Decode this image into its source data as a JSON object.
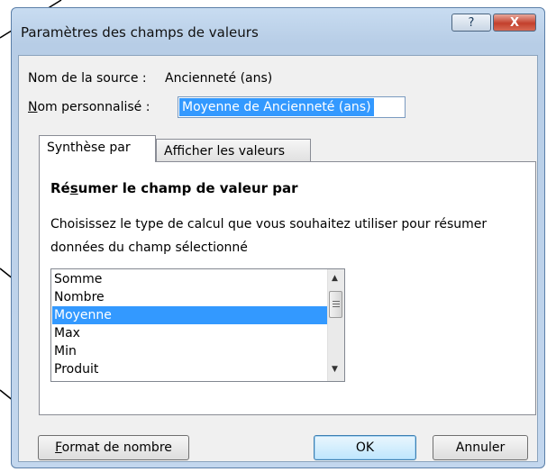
{
  "dialog": {
    "title": "Paramètres des champs de valeurs",
    "help_label": "?",
    "close_label": "X"
  },
  "source": {
    "label": "Nom de la source :",
    "value": "Ancienneté (ans)"
  },
  "custom_name": {
    "label_prefix": "N",
    "label_rest": "om personnalisé :",
    "value": "Moyenne de Ancienneté (ans)"
  },
  "tabs": [
    {
      "label": "Synthèse par",
      "active": true
    },
    {
      "label": "Afficher les valeurs",
      "active": false
    }
  ],
  "summary": {
    "title_pre": "Ré",
    "title_u": "s",
    "title_post": "umer le champ de valeur par",
    "description": "Choisissez le type de calcul que vous souhaitez utiliser pour résumer données du champ sélectionné",
    "items": [
      "Somme",
      "Nombre",
      "Moyenne",
      "Max",
      "Min",
      "Produit"
    ],
    "selected": "Moyenne"
  },
  "buttons": {
    "format_u": "F",
    "format_rest": "ormat de nombre",
    "ok": "OK",
    "cancel": "Annuler"
  }
}
